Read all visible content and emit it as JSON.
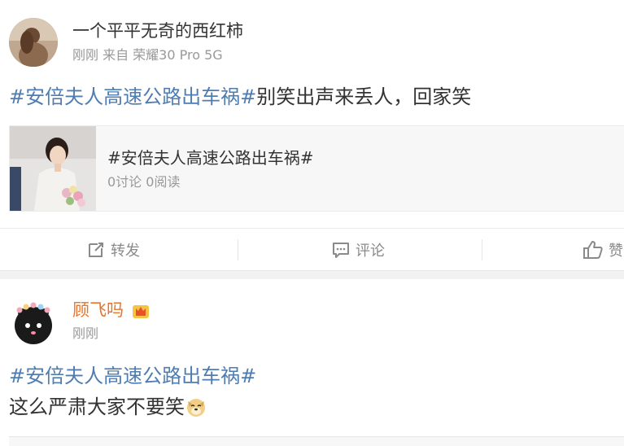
{
  "posts": [
    {
      "username": "一个平平无奇的西红柿",
      "meta": "刚刚 来自 荣耀30 Pro 5G",
      "hashtag": "#安倍夫人高速公路出车祸#",
      "text": "别笑出声来丢人，回家笑",
      "card": {
        "title": "#安倍夫人高速公路出车祸#",
        "stats": "0讨论 0阅读"
      },
      "actions": {
        "repost": "转发",
        "comment": "评论",
        "like": "赞"
      }
    },
    {
      "username": "顾飞吗",
      "meta": "刚刚",
      "hashtag": "#安倍夫人高速公路出车祸#",
      "text": "这么严肃大家不要笑"
    }
  ],
  "colors": {
    "hashtag": "#4f7db1",
    "username_vip": "#e8742a",
    "meta": "#999999",
    "separator": "#f2f2f2"
  },
  "icons": [
    "repost-icon",
    "comment-icon",
    "like-icon",
    "crown-icon",
    "doge-emoji"
  ]
}
